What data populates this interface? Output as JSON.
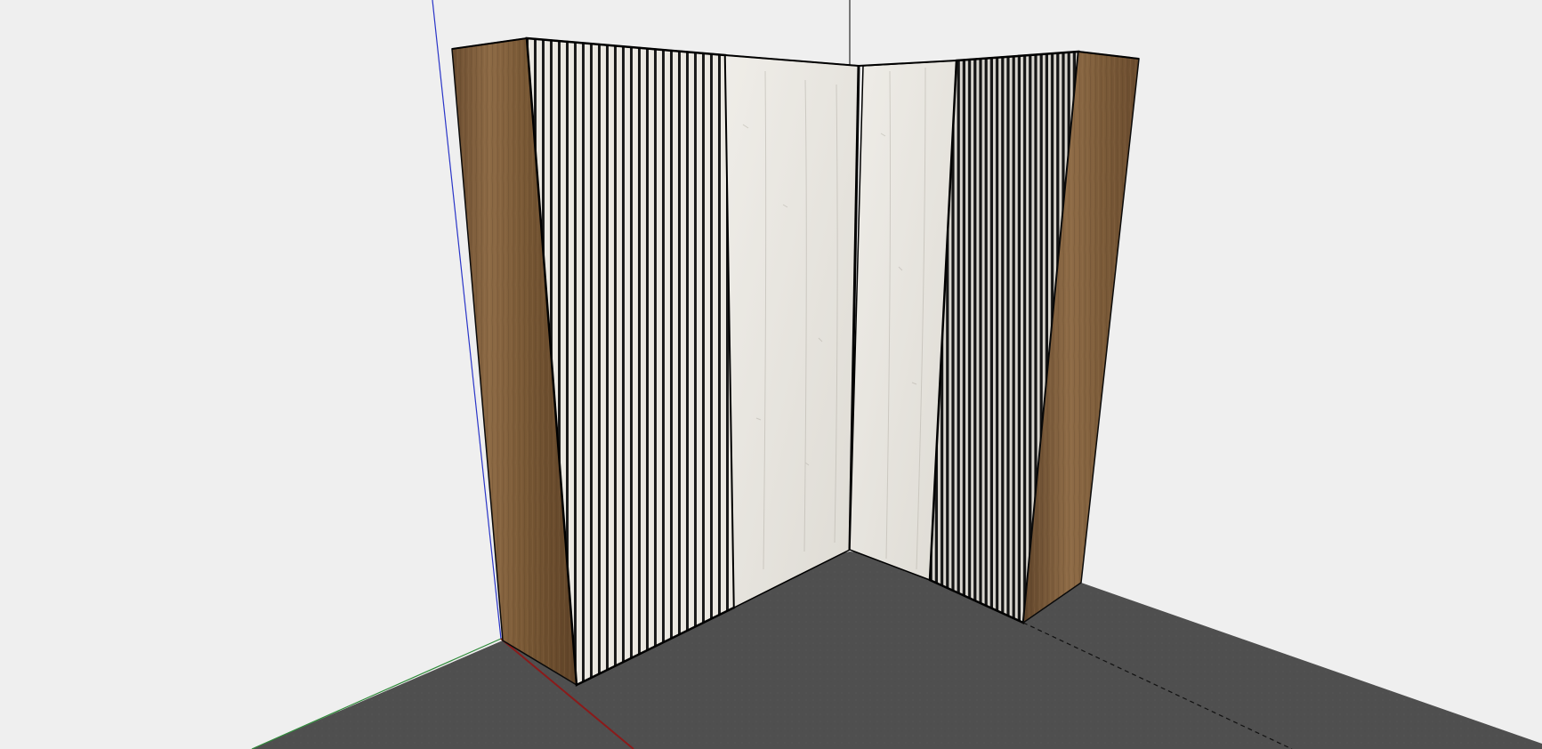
{
  "scene": {
    "background_color": "#efefef",
    "ground_color": "#505050",
    "axis_colors": {
      "blue": "#2a35c8",
      "red": "#8b1a1a",
      "green": "#2f8a3a",
      "black": "#000000"
    },
    "materials": {
      "walnut": "#7a5a3a",
      "walnut_light": "#94724c",
      "slat_light": "#e9e6df",
      "slat_dark": "#1e1e1e",
      "whitewash": "#e6e4de",
      "whitewash_grain": "#b9b5ad",
      "edge": "#0a0a0a"
    },
    "objects": [
      "ground-plane",
      "walnut-end-panel-left",
      "slatted-panel-left",
      "whitewash-panel-left",
      "whitewash-panel-right",
      "slatted-panel-right",
      "walnut-end-panel-right",
      "model-axes"
    ]
  }
}
